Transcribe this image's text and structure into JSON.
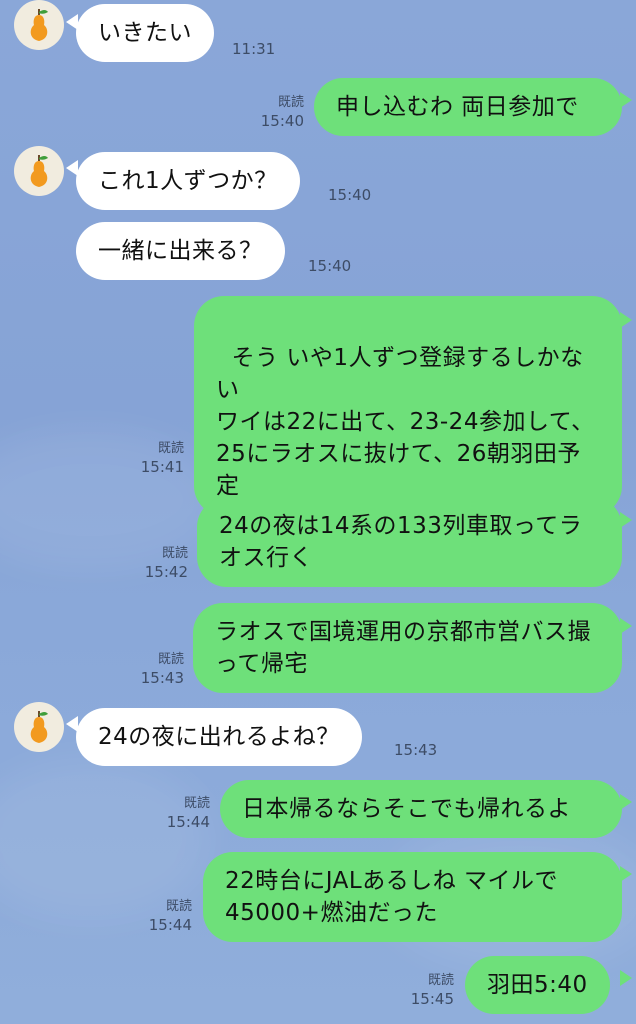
{
  "chat": {
    "messages": [
      {
        "side": "in",
        "text": "いきたい",
        "time": "11:31"
      },
      {
        "side": "out",
        "text": "申し込むわ 両日参加で",
        "read": "既読",
        "time": "15:40"
      },
      {
        "side": "in",
        "text": "これ1人ずつか？",
        "time": "15:40"
      },
      {
        "side": "in",
        "text": "一緒に出来る？",
        "time": "15:40"
      },
      {
        "side": "out",
        "text": "そう いや1人ずつ登録するしかない\nワイは22に出て、23-24参加して、25にラオスに抜けて、26朝羽田予定",
        "read": "既読",
        "time": "15:41"
      },
      {
        "side": "out",
        "text": "24の夜は14系の133列車取ってラオス行く",
        "read": "既読",
        "time": "15:42"
      },
      {
        "side": "out",
        "text": "ラオスで国境運用の京都市営バス撮って帰宅",
        "read": "既読",
        "time": "15:43"
      },
      {
        "side": "in",
        "text": "24の夜に出れるよね？",
        "time": "15:43"
      },
      {
        "side": "out",
        "text": "日本帰るならそこでも帰れるよ",
        "read": "既読",
        "time": "15:44"
      },
      {
        "side": "out",
        "text": "22時台にJALあるしね マイルで45000+燃油だった",
        "read": "既読",
        "time": "15:44"
      },
      {
        "side": "out",
        "text": "羽田5:40",
        "read": "既読",
        "time": "15:45"
      }
    ]
  },
  "colors": {
    "background": "#88a6d8",
    "bubble_out": "#6ee07a",
    "bubble_in": "#ffffff",
    "avatar_bg": "#f1ecdf",
    "pear": "#f29a1f"
  },
  "icons": {
    "avatar": "pear-icon"
  }
}
